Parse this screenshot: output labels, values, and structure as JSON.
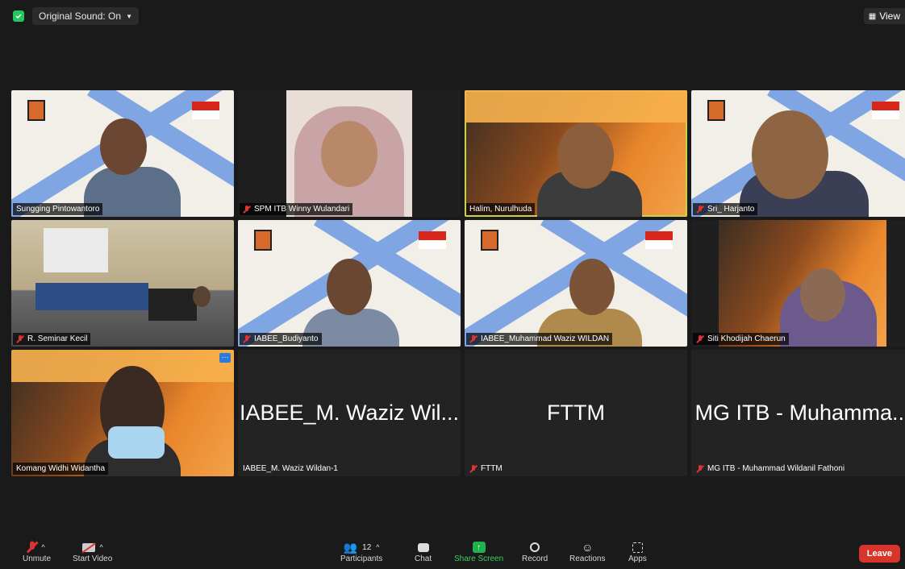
{
  "topbar": {
    "original_sound": "Original Sound: On",
    "view": "View"
  },
  "participants": [
    {
      "name": "Sungging Pintowantoro",
      "muted": false
    },
    {
      "name": "SPM ITB Winny Wulandari",
      "muted": true
    },
    {
      "name": "Halim, Nurulhuda",
      "muted": false,
      "active": true
    },
    {
      "name": "Sri_ Harjanto",
      "muted": true
    },
    {
      "name": "R. Seminar Kecil",
      "muted": true
    },
    {
      "name": "IABEE_Budiyanto",
      "muted": true
    },
    {
      "name": "IABEE_Muhammad Waziz WILDAN",
      "muted": true
    },
    {
      "name": "Siti Khodijah Chaerun",
      "muted": true
    },
    {
      "name": "Komang Widhi Widantha",
      "muted": false
    },
    {
      "name": "IABEE_M. Waziz Wildan-1",
      "muted": false,
      "display": "IABEE_M. Waziz Wil..."
    },
    {
      "name": "FTTM",
      "muted": true,
      "display": "FTTM"
    },
    {
      "name": "MG ITB - Muhammad Wildanil Fathoni",
      "muted": true,
      "display": "MG ITB - Muhamma..."
    }
  ],
  "toolbar": {
    "unmute": "Unmute",
    "start_video": "Start Video",
    "participants": "Participants",
    "participants_count": "12",
    "chat": "Chat",
    "share_screen": "Share Screen",
    "record": "Record",
    "reactions": "Reactions",
    "apps": "Apps",
    "leave": "Leave"
  },
  "colors": {
    "share_green": "#22b24c",
    "leave_red": "#d9342b",
    "active_speaker": "#c9d34a"
  }
}
